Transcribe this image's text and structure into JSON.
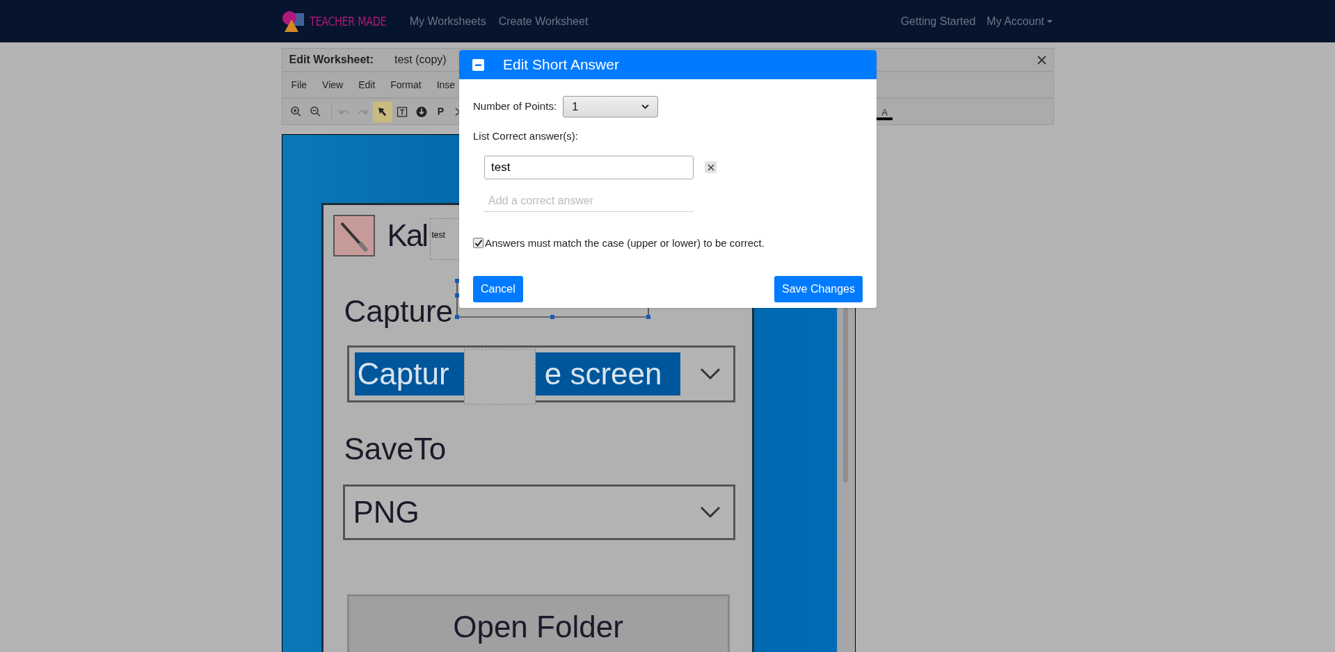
{
  "navbar": {
    "brand": "TEACHER MADE",
    "links": [
      {
        "label": "My Worksheets"
      },
      {
        "label": "Create Worksheet"
      }
    ],
    "right_links": [
      {
        "label": "Getting Started",
        "dropdown": false
      },
      {
        "label": "My Account",
        "dropdown": true
      }
    ]
  },
  "editor": {
    "title_label": "Edit Worksheet:",
    "worksheet_name": "test (copy)",
    "menu": [
      "File",
      "View",
      "Edit",
      "Format",
      "Inse"
    ],
    "toolbar": [
      {
        "kind": "zoom-in",
        "disabled": false,
        "selected": false
      },
      {
        "kind": "zoom-out",
        "disabled": false,
        "selected": false
      },
      {
        "kind": "undo",
        "disabled": true,
        "selected": false
      },
      {
        "kind": "redo",
        "disabled": true,
        "selected": false
      },
      {
        "kind": "pointer",
        "disabled": false,
        "selected": true
      },
      {
        "kind": "text-box",
        "disabled": false,
        "selected": false
      },
      {
        "kind": "download",
        "disabled": false,
        "selected": false
      },
      {
        "kind": "letter",
        "text": "P",
        "disabled": false,
        "selected": false
      },
      {
        "kind": "shuffle",
        "disabled": false,
        "selected": false
      }
    ],
    "font_color_letter": "A"
  },
  "canvas": {
    "image": {
      "title": "Kal",
      "capture_label": "Capture",
      "capture_value_left": "Captur",
      "capture_value_right": "e screen",
      "save_label": "SaveTo",
      "save_value": "PNG",
      "button": "Open Folder"
    },
    "text_box": "test"
  },
  "modal": {
    "title": "Edit Short Answer",
    "points_label": "Number of Points:",
    "points_value": "1",
    "answers_label": "List Correct answer(s):",
    "answers": [
      {
        "value": "test"
      }
    ],
    "new_answer_placeholder": "Add a correct answer",
    "match_case": {
      "checked": true,
      "label": "Answers must match the case (upper or lower) to be correct."
    },
    "buttons": [
      {
        "kind": "cancel",
        "label": "Cancel"
      },
      {
        "kind": "save",
        "label": "Save Changes"
      }
    ]
  }
}
